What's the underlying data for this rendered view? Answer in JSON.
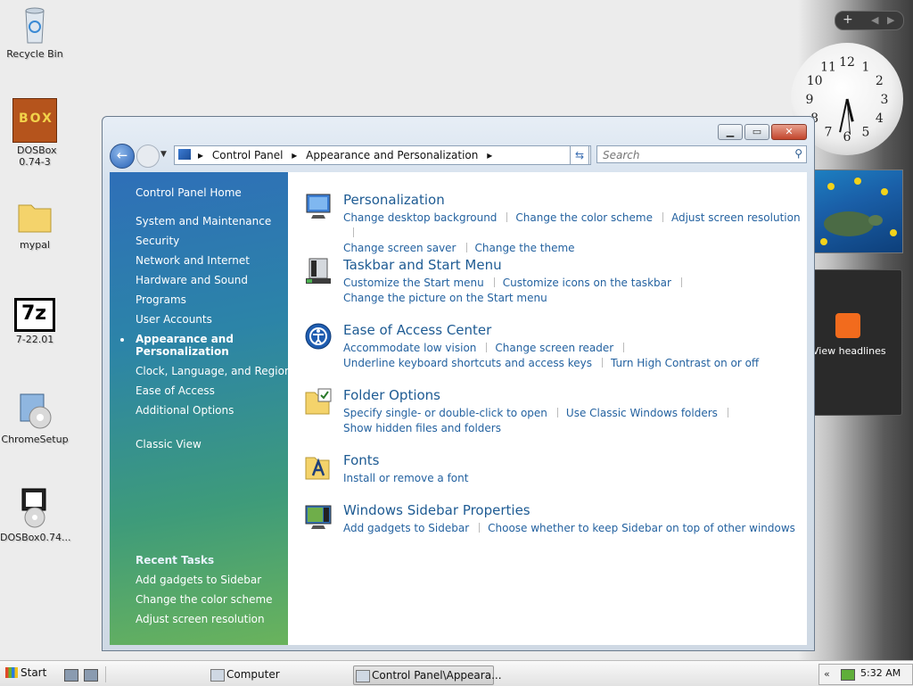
{
  "desktop": {
    "icons": [
      {
        "label": "Recycle Bin"
      },
      {
        "label": "DOSBox 0.74-3",
        "logo_text": "BOX"
      },
      {
        "label": "mypal"
      },
      {
        "label": "7-22.01",
        "logo_text": "7z"
      },
      {
        "label": "ChromeSetup"
      },
      {
        "label": "DOSBox0.74..."
      }
    ]
  },
  "sidebar": {
    "clock_numbers": [
      "12",
      "1",
      "2",
      "3",
      "4",
      "5",
      "6",
      "7",
      "8",
      "9",
      "10",
      "11"
    ],
    "news_label": "View headlines"
  },
  "window": {
    "address": {
      "crumbs": [
        "Control Panel",
        "Appearance and Personalization"
      ]
    },
    "search": {
      "placeholder": "Search"
    },
    "left": {
      "home": "Control Panel Home",
      "items": [
        "System and Maintenance",
        "Security",
        "Network and Internet",
        "Hardware and Sound",
        "Programs",
        "User Accounts"
      ],
      "current_line1": "Appearance and",
      "current_line2": "Personalization",
      "items2": [
        "Clock, Language, and Region",
        "Ease of Access",
        "Additional Options"
      ],
      "classic_view": "Classic View",
      "recent_title": "Recent Tasks",
      "recent": [
        "Add gadgets to Sidebar",
        "Change the color scheme",
        "Adjust screen resolution"
      ]
    },
    "categories": [
      {
        "title": "Personalization",
        "icon": "monitor-icon",
        "links_row1": [
          "Change desktop background",
          "Change the color scheme",
          "Adjust screen resolution"
        ],
        "links_row2": [
          "Change screen saver",
          "Change the theme"
        ]
      },
      {
        "title": "Taskbar and Start Menu",
        "icon": "taskbar-icon",
        "links_row1": [
          "Customize the Start menu",
          "Customize icons on the taskbar"
        ],
        "links_row2": [
          "Change the picture on the Start menu"
        ]
      },
      {
        "title": "Ease of Access Center",
        "icon": "ease-of-access-icon",
        "links_row1": [
          "Accommodate low vision",
          "Change screen reader"
        ],
        "links_row2": [
          "Underline keyboard shortcuts and access keys",
          "Turn High Contrast on or off"
        ]
      },
      {
        "title": "Folder Options",
        "icon": "folder-options-icon",
        "links_row1": [
          "Specify single- or double-click to open",
          "Use Classic Windows folders"
        ],
        "links_row2": [
          "Show hidden files and folders"
        ]
      },
      {
        "title": "Fonts",
        "icon": "fonts-folder-icon",
        "links_row1": [
          "Install or remove a font"
        ],
        "links_row2": []
      },
      {
        "title": "Windows Sidebar Properties",
        "icon": "sidebar-properties-icon",
        "links_row1": [
          "Add gadgets to Sidebar",
          "Choose whether to keep Sidebar on top of other windows"
        ],
        "links_row2": []
      }
    ]
  },
  "taskbar": {
    "start": "Start",
    "computer": "Computer",
    "active_window": "Control Panel\\Appeara...",
    "time": "5:32 AM"
  },
  "colors": {
    "link": "#2462a0",
    "title": "#1e5b93",
    "accent": "#2e6fb8"
  }
}
